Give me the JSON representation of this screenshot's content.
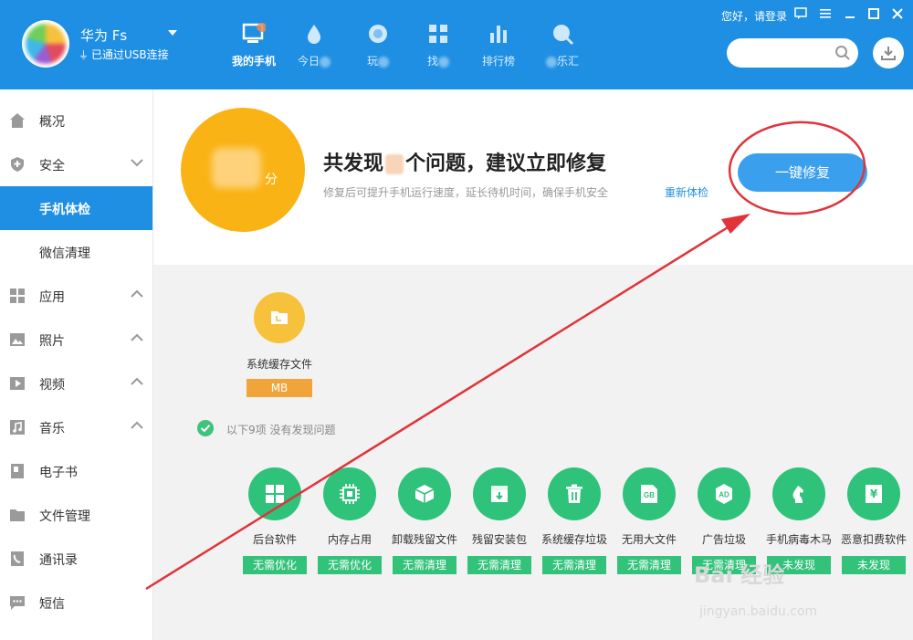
{
  "header": {
    "device_name": "华为 Fs",
    "connection": "已通过USB连接",
    "login_text": "您好，请登录",
    "nav": [
      {
        "label": "我的手机",
        "icon": "phone-monitor-icon",
        "active": true
      },
      {
        "label": "今日",
        "icon": "drop-icon",
        "active": false
      },
      {
        "label": "玩",
        "icon": "game-icon",
        "active": false
      },
      {
        "label": "找",
        "icon": "find-icon",
        "active": false
      },
      {
        "label": "排行榜",
        "icon": "chart-icon",
        "active": false
      },
      {
        "label": "乐汇",
        "icon": "music-search-icon",
        "active": false
      }
    ]
  },
  "sidebar": {
    "items": [
      {
        "label": "概况",
        "icon": "home-icon"
      },
      {
        "label": "安全",
        "icon": "shield-icon"
      },
      {
        "label": "手机体检",
        "icon": ""
      },
      {
        "label": "微信清理",
        "icon": ""
      },
      {
        "label": "应用",
        "icon": "grid-icon"
      },
      {
        "label": "照片",
        "icon": "image-icon"
      },
      {
        "label": "视频",
        "icon": "play-icon"
      },
      {
        "label": "音乐",
        "icon": "music-icon"
      },
      {
        "label": "电子书",
        "icon": "book-icon"
      },
      {
        "label": "文件管理",
        "icon": "folder-icon"
      },
      {
        "label": "通讯录",
        "icon": "contacts-icon"
      },
      {
        "label": "短信",
        "icon": "sms-icon"
      }
    ]
  },
  "checkup": {
    "score_unit": "分",
    "title_prefix": "共发现",
    "title_suffix": "个问题，建议立即修复",
    "subtitle": "修复后可提升手机运行速度，延长待机时间，确保手机安全",
    "recheck": "重新体检",
    "fix_button": "一键修复",
    "cache": {
      "label": "系统缓存文件",
      "size": "MB"
    },
    "ok_text": "以下9项 没有发现问题",
    "items": [
      {
        "label": "后台软件",
        "status": "无需优化",
        "icon": "apps-grid-icon"
      },
      {
        "label": "内存占用",
        "status": "无需优化",
        "icon": "chip-icon"
      },
      {
        "label": "卸载残留文件",
        "status": "无需清理",
        "icon": "box-icon"
      },
      {
        "label": "残留安装包",
        "status": "无需清理",
        "icon": "package-icon"
      },
      {
        "label": "系统缓存垃圾",
        "status": "无需清理",
        "icon": "trash-icon"
      },
      {
        "label": "无用大文件",
        "status": "无需清理",
        "icon": "gb-file-icon"
      },
      {
        "label": "广告垃圾",
        "status": "无需清理",
        "icon": "ad-icon"
      },
      {
        "label": "手机病毒木马",
        "status": "未发现",
        "icon": "trojan-icon"
      },
      {
        "label": "恶意扣费软件",
        "status": "未发现",
        "icon": "yen-icon"
      }
    ]
  },
  "watermark": {
    "text": "Bai 经验",
    "url": "jingyan.baidu.com"
  },
  "colors": {
    "primary": "#1e8fe3",
    "score": "#fab314",
    "ok_green": "#2fc27a",
    "annotation": "#e0333a"
  }
}
